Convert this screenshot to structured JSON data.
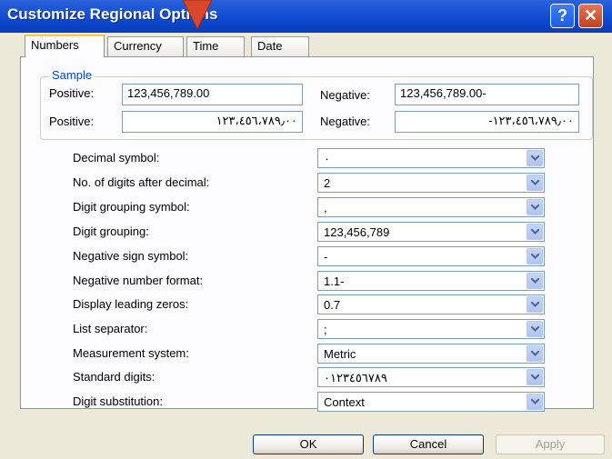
{
  "window": {
    "title": "Customize Regional Options"
  },
  "tabs": [
    {
      "label": "Numbers"
    },
    {
      "label": "Currency"
    },
    {
      "label": "Time"
    },
    {
      "label": "Date"
    }
  ],
  "sample": {
    "label": "Sample",
    "rows": [
      {
        "pos_label": "Positive:",
        "pos_value": "123,456,789.00",
        "neg_label": "Negative:",
        "neg_value": "123,456,789.00-"
      },
      {
        "pos_label": "Positive:",
        "pos_value": "١٢٣،٤٥٦،٧٨٩٫٠٠",
        "neg_label": "Negative:",
        "neg_value": "-١٢٣،٤٥٦،٧٨٩٫٠٠"
      }
    ]
  },
  "settings": [
    {
      "label": "Decimal symbol:",
      "value": "٠"
    },
    {
      "label": "No. of digits after decimal:",
      "value": "2"
    },
    {
      "label": "Digit grouping symbol:",
      "value": ","
    },
    {
      "label": "Digit grouping:",
      "value": "123,456,789"
    },
    {
      "label": "Negative sign symbol:",
      "value": "-"
    },
    {
      "label": "Negative number format:",
      "value": "1.1-"
    },
    {
      "label": "Display leading zeros:",
      "value": "0.7"
    },
    {
      "label": "List separator:",
      "value": ";"
    },
    {
      "label": "Measurement system:",
      "value": "Metric"
    },
    {
      "label": "Standard digits:",
      "value": "٠١٢٣٤٥٦٧٨٩"
    },
    {
      "label": "Digit substitution:",
      "value": "Context"
    }
  ],
  "buttons": {
    "ok": "OK",
    "cancel": "Cancel",
    "apply": "Apply"
  },
  "colors": {
    "titlebar": "#0b45c9",
    "tab_highlight": "#ffc83c",
    "arrow": "#d8462b"
  }
}
